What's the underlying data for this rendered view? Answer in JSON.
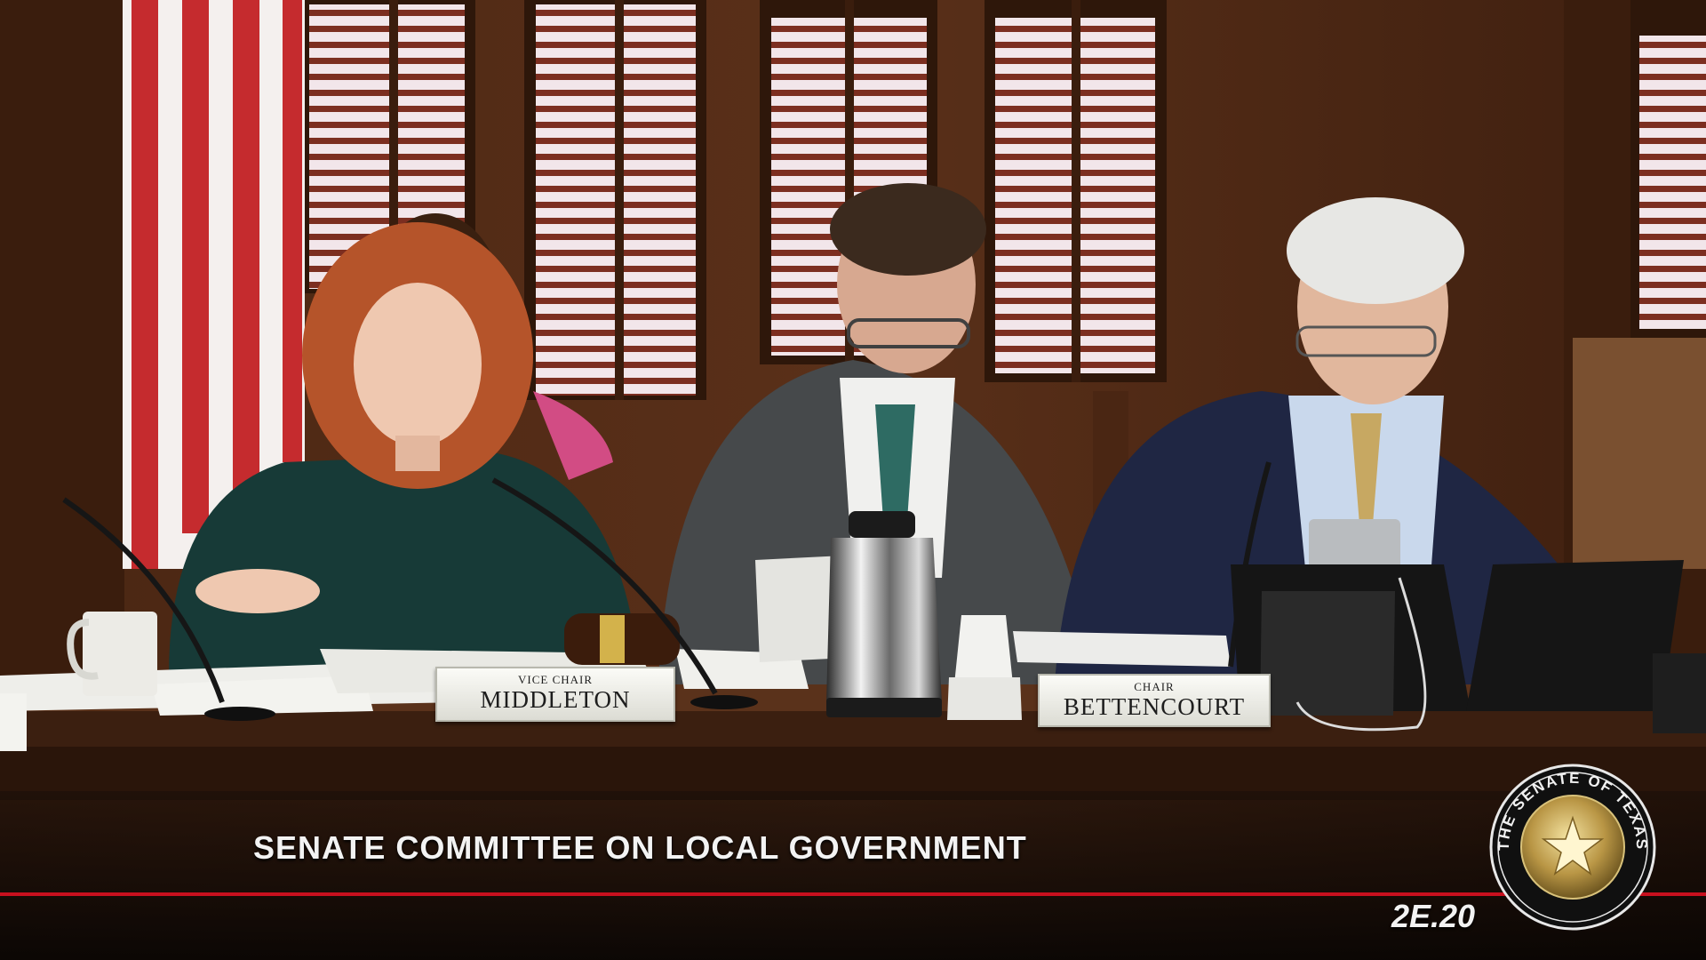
{
  "nameplates": {
    "vice_chair": {
      "title": "VICE CHAIR",
      "name": "MIDDLETON"
    },
    "chair": {
      "title": "CHAIR",
      "name": "BETTENCOURT"
    }
  },
  "broadcast": {
    "caption": "SENATE COMMITTEE ON LOCAL GOVERNMENT",
    "room_code": "2E.20",
    "accent_color": "#c8101e"
  },
  "seal": {
    "text": "THE SENATE OF TEXAS",
    "icon": "texas-senate-seal-icon"
  }
}
